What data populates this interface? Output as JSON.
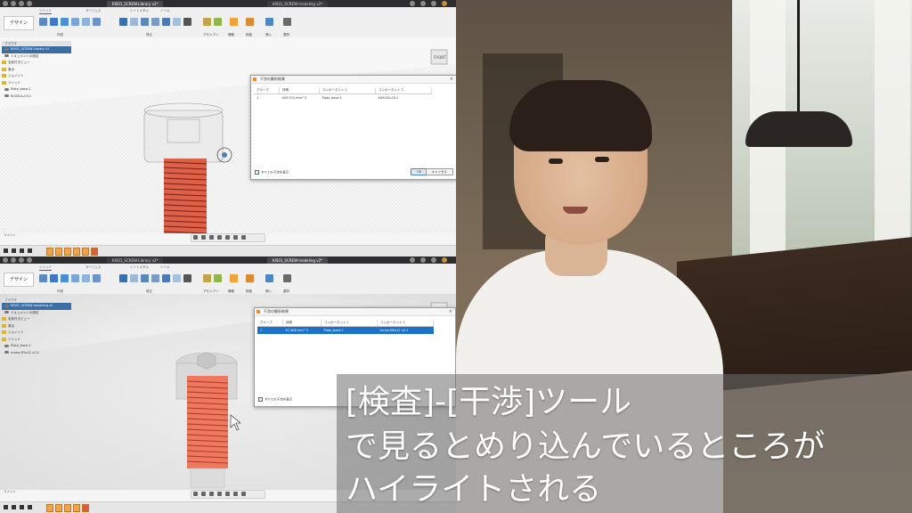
{
  "caption": {
    "line1": "[検査]-[干渉]ツール",
    "line2": "で見るとめり込んでいるところが",
    "line3": "ハイライトされる"
  },
  "fusion_top": {
    "tabs": [
      "KIS01_SCREW-Library v2*",
      "KIS01_SCREW-modeling v2*"
    ],
    "workspace_button": "デザイン",
    "ribbon_tabs": [
      "ソリッド",
      "サーフェス",
      "シートメタル",
      "ツール"
    ],
    "ribbon_groups": [
      "作成",
      "修正",
      "アセンブリ",
      "構築",
      "検査",
      "挿入",
      "選択"
    ],
    "browser": {
      "header": "ブラウザ",
      "items": [
        "KIS01_SCREW-Library v2",
        "ドキュメントの設定",
        "名前付きビュー",
        "原点",
        "ジョイント",
        "ソリッド",
        "Plate_base:1",
        "KU302A-CS:1"
      ]
    },
    "dialog": {
      "title": "干渉の解析結果",
      "headers": [
        "グループ",
        "体積",
        "コンポーネント 1",
        "コンポーネント 2"
      ],
      "rows": [
        [
          "1",
          "405.374 mm^3",
          "Plate_base:1",
          "KU302A-CS:1"
        ]
      ],
      "checkbox_label": "すべての干渉を表示",
      "ok_label": "OK",
      "cancel_label": "キャンセル"
    },
    "comments_label": "コメント"
  },
  "fusion_bottom": {
    "tabs": [
      "KIS01_SCREW-Library v2*",
      "KIS01_SCREW-modeling v2*"
    ],
    "workspace_button": "デザイン",
    "ribbon_tabs": [
      "ソリッド",
      "サーフェス",
      "シートメタル",
      "ツール"
    ],
    "ribbon_groups": [
      "作成",
      "修正",
      "アセンブリ",
      "構築",
      "検査",
      "挿入",
      "選択"
    ],
    "browser": {
      "header": "ブラウザ",
      "items": [
        "KIS01_SCREW-modeling v2",
        "ドキュメントの設定",
        "名前付きビュー",
        "原点",
        "ジョイント",
        "ソリッド",
        "Plate_base:1",
        "screw-M5x12 v2:1"
      ]
    },
    "dialog": {
      "title": "干渉の解析結果",
      "headers": [
        "グループ",
        "体積",
        "コンポーネント 1",
        "コンポーネント 2"
      ],
      "rows": [
        [
          "1",
          "57.408 mm^3",
          "Plate_base:1",
          "screw-M5x12 v2:1"
        ]
      ],
      "checkbox_label": "すべての干渉を表示"
    },
    "comments_label": "コメント"
  },
  "colors": {
    "interference": "#e0492c",
    "selection": "#1a73c9",
    "caption_bg": "rgba(110,110,110,0.55)"
  }
}
